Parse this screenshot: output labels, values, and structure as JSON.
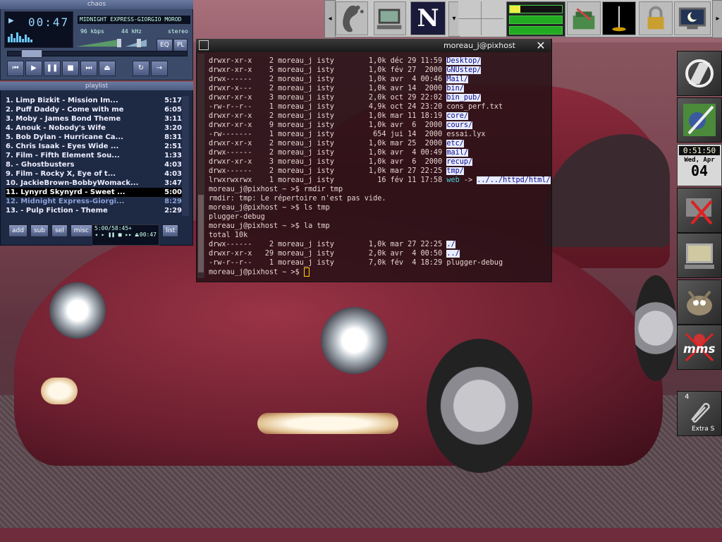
{
  "player": {
    "title": "chaos",
    "time": "00:47",
    "song": "MIDNIGHT EXPRESS-GIORGIO MOROD",
    "kbps": "96",
    "kbps_unit": "kbps",
    "khz": "44",
    "khz_unit": "kHz",
    "stereo": "stereo",
    "eq": "EQ",
    "pl": "PL"
  },
  "playlist": {
    "title": "playlist",
    "items": [
      {
        "label": "1. Limp Bizkit - Mission Im...",
        "time": "5:17"
      },
      {
        "label": "2. Puff Daddy - Come with me",
        "time": "6:05"
      },
      {
        "label": "3. Moby - James Bond Theme",
        "time": "3:11"
      },
      {
        "label": "4. Anouk - Nobody's Wife",
        "time": "3:20"
      },
      {
        "label": "5. Bob Dylan - Hurricane Ca...",
        "time": "8:31"
      },
      {
        "label": "6. Chris Isaak - Eyes Wide ...",
        "time": "2:51"
      },
      {
        "label": "7. Film - Fifth Element Sou...",
        "time": "1:33"
      },
      {
        "label": "8. - Ghostbusters",
        "time": "4:03"
      },
      {
        "label": "9. Film - Rocky X, Eye of t...",
        "time": "4:03"
      },
      {
        "label": "10. JackieBrown-BobbyWomack...",
        "time": "3:47"
      },
      {
        "label": "11. Lynyrd Skynyrd - Sweet ...",
        "time": "5:00"
      },
      {
        "label": "12. Midnight Express-Giorgi...",
        "time": "8:29"
      },
      {
        "label": "13. - Pulp Fiction - Theme",
        "time": "2:29"
      }
    ],
    "buttons": {
      "add": "add",
      "sub": "sub",
      "sel": "sel",
      "misc": "misc",
      "list": "list"
    },
    "total": "5:00/58:45+",
    "elapsed": "00:47"
  },
  "terminal": {
    "title": "moreau_j@pixhost",
    "lines": [
      {
        "pre": "drwxr-xr-x    2 moreau_j isty        1,0k déc 29 11:59 ",
        "name": "Desktop",
        "post": "/",
        "kind": "dir"
      },
      {
        "pre": "drwxr-xr-x    5 moreau_j isty        1,0k fév 27  2000 ",
        "name": "GNUstep",
        "post": "/",
        "kind": "dir"
      },
      {
        "pre": "drwx------    2 moreau_j isty        1,0k avr  4 00:46 ",
        "name": "Mail",
        "post": "/",
        "kind": "dir"
      },
      {
        "pre": "drwxr-x---    2 moreau_j isty        1,0k avr 14  2000 ",
        "name": "bin",
        "post": "/",
        "kind": "dir"
      },
      {
        "pre": "drwxr-xr-x    3 moreau_j isty        2,0k oct 29 22:02 ",
        "name": "bin_pub",
        "post": "/",
        "kind": "dir"
      },
      {
        "pre": "-rw-r--r--    1 moreau_j isty        4,9k oct 24 23:20 ",
        "name": "cons_perf.txt",
        "post": "",
        "kind": "file"
      },
      {
        "pre": "drwxr-xr-x    2 moreau_j isty        1,0k mar 11 18:19 ",
        "name": "core",
        "post": "/",
        "kind": "dir"
      },
      {
        "pre": "drwxr-xr-x    9 moreau_j isty        1,0k avr  6  2000 ",
        "name": "cours",
        "post": "/",
        "kind": "dir"
      },
      {
        "pre": "-rw-------    1 moreau_j isty         654 jui 14  2000 ",
        "name": "essai.lyx",
        "post": "",
        "kind": "file"
      },
      {
        "pre": "drwxr-xr-x    2 moreau_j isty        1,0k mar 25  2000 ",
        "name": "etc",
        "post": "/",
        "kind": "dir"
      },
      {
        "pre": "drwx------    2 moreau_j isty        1,0k avr  4 00:49 ",
        "name": "mail",
        "post": "/",
        "kind": "dir"
      },
      {
        "pre": "drwxr-xr-x    3 moreau_j isty        1,0k avr  6  2000 ",
        "name": "recup",
        "post": "/",
        "kind": "dir"
      },
      {
        "pre": "drwx------    2 moreau_j isty        1,0k mar 27 22:25 ",
        "name": "tmp",
        "post": "/",
        "kind": "dir"
      },
      {
        "pre": "lrwxrwxrwx    1 moreau_j isty          16 fév 11 17:58 ",
        "name": "web",
        "post": " -> ",
        "kind": "link",
        "target": "../../httpd/html",
        "tpost": "/"
      },
      {
        "pre": "moreau_j@pixhost ~ >$ rmdir tmp",
        "name": "",
        "post": "",
        "kind": "plain"
      },
      {
        "pre": "rmdir: tmp: Le répertoire n'est pas vide.",
        "name": "",
        "post": "",
        "kind": "plain"
      },
      {
        "pre": "moreau_j@pixhost ~ >$ ls tmp",
        "name": "",
        "post": "",
        "kind": "plain"
      },
      {
        "pre": "plugger-debug",
        "name": "",
        "post": "",
        "kind": "plain"
      },
      {
        "pre": "moreau_j@pixhost ~ >$ la tmp",
        "name": "",
        "post": "",
        "kind": "plain"
      },
      {
        "pre": "total 10k",
        "name": "",
        "post": "",
        "kind": "plain"
      },
      {
        "pre": "drwx------    2 moreau_j isty        1,0k mar 27 22:25 ",
        "name": ".",
        "post": "/",
        "kind": "dir"
      },
      {
        "pre": "drwxr-xr-x   29 moreau_j isty        2,0k avr  4 00:50 ",
        "name": "..",
        "post": "/",
        "kind": "dir"
      },
      {
        "pre": "-rw-r--r--    1 moreau_j isty        7,0k fév  4 18:29 ",
        "name": "plugger-debug",
        "post": "",
        "kind": "file"
      }
    ],
    "prompt": "moreau_j@pixhost ~ >$ "
  },
  "clock": {
    "time": "0:51:50",
    "day": "Wed, Apr",
    "date": "04"
  },
  "dock": {
    "workspace": "4",
    "workspace_label": "Extra S",
    "mms": "mms"
  },
  "panel": {
    "netscape_letter": "N"
  }
}
